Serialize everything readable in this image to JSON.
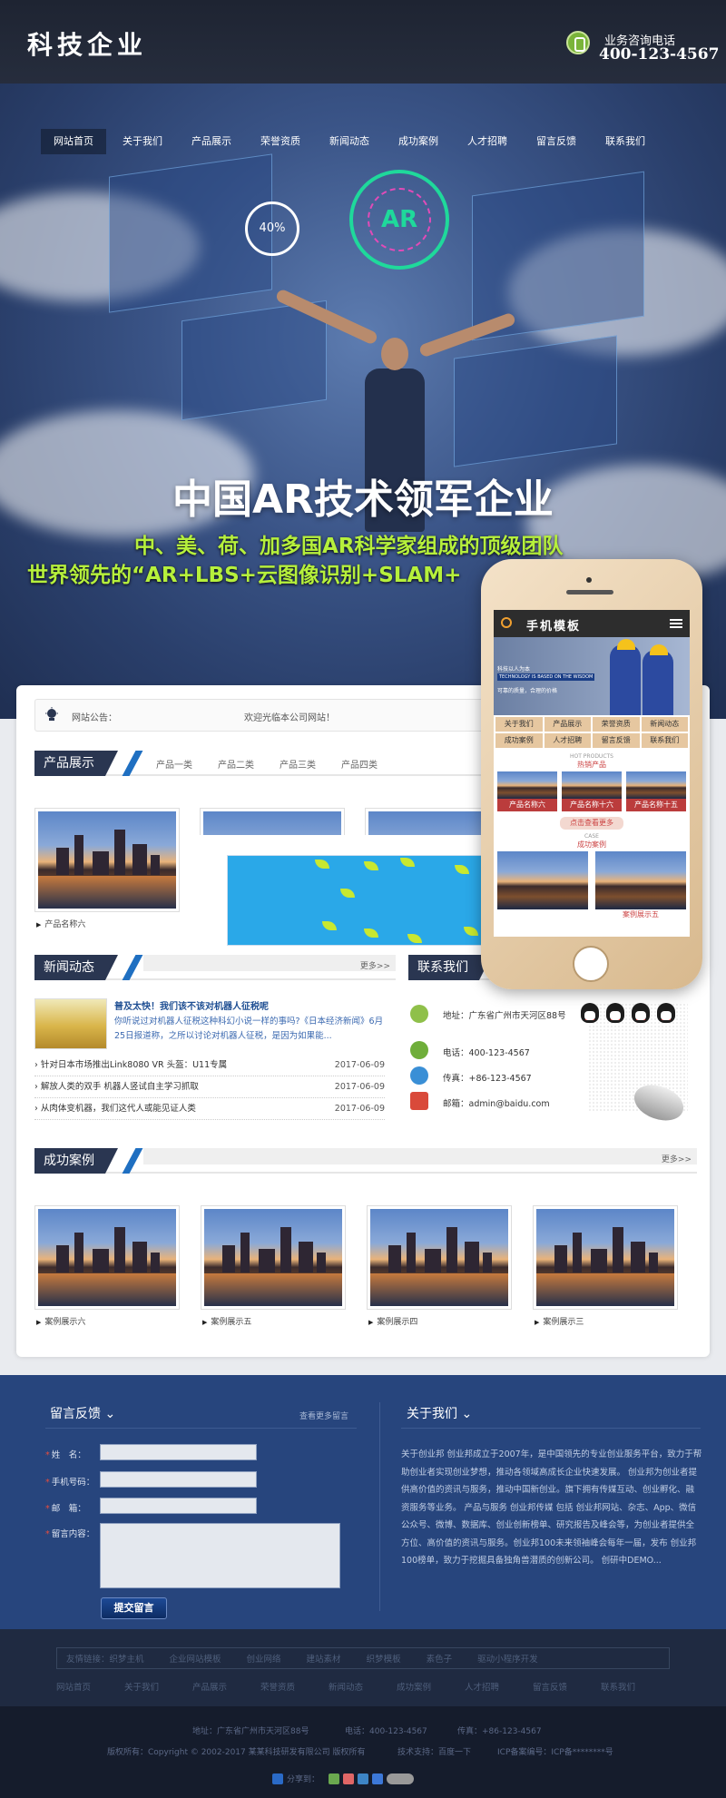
{
  "header": {
    "logo": "科技企业",
    "phone_label": "业务咨询电话",
    "phone_number": "400-123-4567"
  },
  "nav": [
    "网站首页",
    "关于我们",
    "产品展示",
    "荣誉资质",
    "新闻动态",
    "成功案例",
    "人才招聘",
    "留言反馈",
    "联系我们"
  ],
  "banner": {
    "ring_text": "AR",
    "percent": "40%",
    "headline": "中国AR技术领军企业",
    "sub1": "中、美、荷、加多国AR科学家组成的顶级团队",
    "sub2": "世界领先的“AR+LBS+云图像识别+SLAM+"
  },
  "notice": {
    "label": "网站公告：",
    "message": "欢迎光临本公司网站！"
  },
  "products": {
    "title": "产品展示",
    "tabs": [
      "产品一类",
      "产品二类",
      "产品三类",
      "产品四类"
    ],
    "items": [
      "产品名称六"
    ]
  },
  "news": {
    "title": "新闻动态",
    "more": "更多>>",
    "featured_title": "普及太快！我们该不该对机器人征税呢",
    "featured_desc": "你听说过对机器人征税这种科幻小说一样的事吗?《日本经济新闻》6月25日报道称，之所以讨论对机器人征税，是因为如果能...",
    "list": [
      {
        "title": "针对日本市场推出Link8080 VR 头盔：U11专属",
        "date": "2017-06-09"
      },
      {
        "title": "解放人类的双手 机器人竖试自主学习抓取",
        "date": "2017-06-09"
      },
      {
        "title": "从肉体变机器，我们这代人或能见证人类",
        "date": "2017-06-09"
      }
    ]
  },
  "contact": {
    "title": "联系我们",
    "address": "地址：广东省广州市天河区88号",
    "tel": "电话：400-123-4567",
    "fax": "传真：+86-123-4567",
    "email": "邮箱：admin@baidu.com"
  },
  "cases": {
    "title": "成功案例",
    "more": "更多>>",
    "items": [
      "案例展示六",
      "案例展示五",
      "案例展示四",
      "案例展示三"
    ]
  },
  "phone_mockup": {
    "title": "手机模板",
    "banner_line1": "科技以人为本",
    "banner_line2": "TECHNOLOGY IS BASED ON THE WISDOM",
    "banner_line3": "可靠的质量，合理的价格",
    "menu": [
      "关于我们",
      "产品展示",
      "荣誉资质",
      "新闻动态",
      "成功案例",
      "人才招聘",
      "留言反馈",
      "联系我们"
    ],
    "hot_en": "HOT PRODUCTS",
    "hot_cn": "热销产品",
    "products": [
      "产品名称六",
      "产品名称十六",
      "产品名称十五"
    ],
    "more_btn": "点击查看更多",
    "case_en": "CASE",
    "case_cn": "成功案例",
    "cases": [
      "",
      "案例展示五"
    ]
  },
  "feedback": {
    "title": "留言反馈",
    "view_more": "查看更多留言",
    "name_label": "姓　名：",
    "phone_label": "手机号码：",
    "email_label": "邮　箱：",
    "content_label": "留言内容：",
    "submit": "提交留言"
  },
  "about": {
    "title": "关于我们",
    "text": "关于创业邦 创业邦成立于2007年，是中国领先的专业创业服务平台，致力于帮助创业者实现创业梦想，推动各领域高成长企业快速发展。 创业邦为创业者提供高价值的资讯与服务，推动中国新创业。旗下拥有传媒互动、创业孵化、融资服务等业务。 产品与服务 创业邦传媒 包括 创业邦网站、杂志、App、微信公众号、微博、数据库、创业创新榜单、研究报告及峰会等，为创业者提供全方位、高价值的资讯与服务。创业邦100未来领袖峰会每年一届，发布 创业邦100榜单，致力于挖掘具备独角兽潜质的创新公司。 创研中DEMO..."
  },
  "friend_links": [
    "友情链接：织梦主机",
    "企业网站模板",
    "创业网络",
    "建站素材",
    "织梦模板",
    "驱动小程序开发"
  ],
  "friend_links_extra": "素色子",
  "footer_nav": [
    "网站首页",
    "关于我们",
    "产品展示",
    "荣誉资质",
    "新闻动态",
    "成功案例",
    "人才招聘",
    "留言反馈",
    "联系我们"
  ],
  "bottom": {
    "address": "地址：广东省广州市天河区88号",
    "tel": "电话：400-123-4567",
    "fax": "传真：+86-123-4567",
    "copyright": "版权所有：Copyright © 2002-2017 某某科技研发有限公司 版权所有",
    "support": "技术支持：百度一下",
    "icp": "ICP备案编号：ICP备********号",
    "share_label": "分享到："
  },
  "colors": {
    "header_bg": "#1e2432",
    "section_title_bg": "#2a3651",
    "accent_blue": "#1f6fc1",
    "footer_bg": "#27457d",
    "headline_green": "#b6f03c"
  }
}
